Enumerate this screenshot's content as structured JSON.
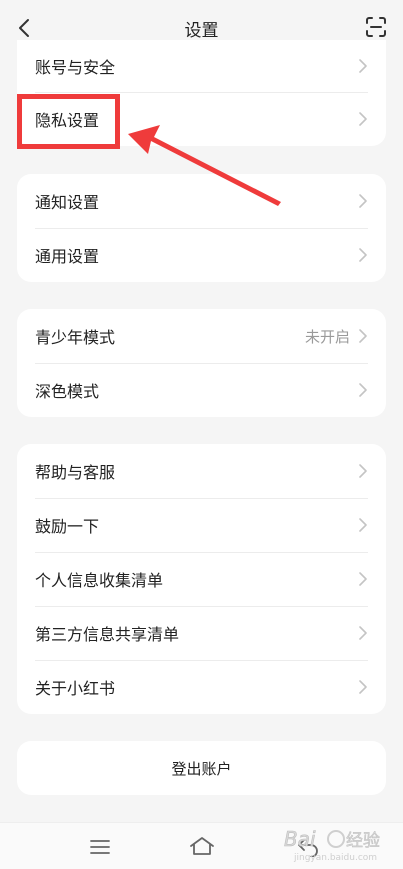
{
  "header": {
    "title": "设置",
    "back_icon": "chevron-left-icon",
    "scan_icon": "scan-icon"
  },
  "groups": [
    {
      "items": [
        {
          "label": "账号与安全"
        },
        {
          "label": "隐私设置"
        }
      ]
    },
    {
      "items": [
        {
          "label": "通知设置"
        },
        {
          "label": "通用设置"
        }
      ]
    },
    {
      "items": [
        {
          "label": "青少年模式",
          "value": "未开启"
        },
        {
          "label": "深色模式"
        }
      ]
    },
    {
      "items": [
        {
          "label": "帮助与客服"
        },
        {
          "label": "鼓励一下"
        },
        {
          "label": "个人信息收集清单"
        },
        {
          "label": "第三方信息共享清单"
        },
        {
          "label": "关于小红书"
        }
      ]
    }
  ],
  "logout_label": "登出账户",
  "navbar": {
    "menu_icon": "menu-icon",
    "home_icon": "home-icon",
    "back_icon": "back-icon"
  },
  "annotation": {
    "color": "#ef3b3b"
  },
  "watermark": {
    "brand": "Bai",
    "brand2": "经验",
    "sub": "jingyan.baidu.com"
  }
}
